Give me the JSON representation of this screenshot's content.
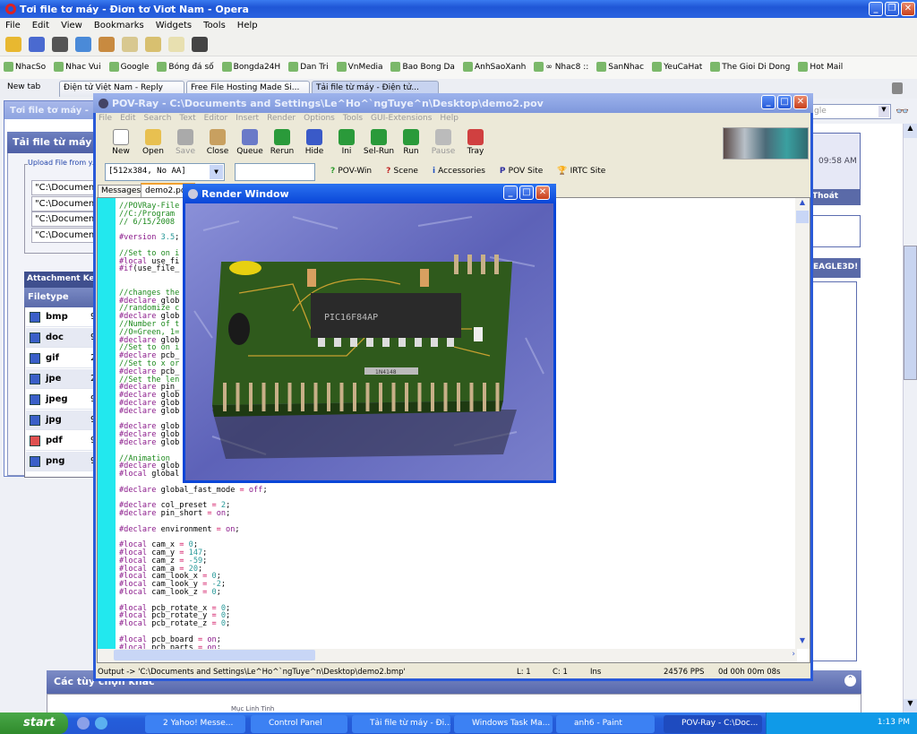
{
  "opera": {
    "title": "Tơi file tơ máy - Điơn tơ Viơt Nam - Opera",
    "menu": [
      "File",
      "Edit",
      "View",
      "Bookmarks",
      "Widgets",
      "Tools",
      "Help"
    ],
    "toolbar_icons": [
      "open-folder-icon",
      "save-icon",
      "print-icon",
      "find-icon",
      "home-icon",
      "notes-icon",
      "panels-icon",
      "pages-icon",
      "wand-icon"
    ],
    "bookmarks": [
      "NhacSo",
      "Nhac Vui",
      "Google",
      "Bóng đá số",
      "Bongda24H",
      "Dan Tri",
      "VnMedia",
      "Bao Bong Da",
      "AnhSaoXanh",
      "∞ Nhac8 ::",
      "SanNhac",
      "YeuCaHat",
      "The Gioi Di Dong",
      "Hot Mail"
    ],
    "tabs": [
      {
        "label": "New tab"
      },
      {
        "label": "Điện tử Việt Nam - Reply"
      },
      {
        "label": "Free File Hosting Made Si..."
      },
      {
        "label": "Tải file từ máy - Điện tử..."
      }
    ],
    "search_placeholder": "gle",
    "right_panel": {
      "time": "09:58 AM",
      "logout": "Thoát",
      "eagle": "EAGLE3D!"
    },
    "bottom": {
      "title": "Các tùy chọn khác",
      "fieldset": "Mục Linh Tinh"
    }
  },
  "upload_window": {
    "title": "Tơi file tơ máy -",
    "heading": "Tải file từ máy",
    "legend": "Upload File from y",
    "inputs": [
      "\"C:\\Documen",
      "\"C:\\Documen",
      "\"C:\\Documen",
      "\"C:\\Documen"
    ],
    "attach_title": "Attachment Key",
    "col_header": "Filetype",
    "rows": [
      {
        "ext": "bmp",
        "v": "9"
      },
      {
        "ext": "doc",
        "v": "9"
      },
      {
        "ext": "gif",
        "v": "2"
      },
      {
        "ext": "jpe",
        "v": "2"
      },
      {
        "ext": "jpeg",
        "v": "9"
      },
      {
        "ext": "jpg",
        "v": "9"
      },
      {
        "ext": "pdf",
        "v": "9"
      },
      {
        "ext": "png",
        "v": "9"
      }
    ]
  },
  "povray": {
    "title": "POV-Ray - C:\\Documents and Settings\\Le^Ho^`ngTuye^n\\Desktop\\demo2.pov",
    "menu": [
      "File",
      "Edit",
      "Search",
      "Text",
      "Editor",
      "Insert",
      "Render",
      "Options",
      "Tools",
      "GUI-Extensions",
      "Help"
    ],
    "toolbar": [
      "New",
      "Open",
      "Save",
      "Close",
      "Queue",
      "Rerun",
      "Hide",
      "Ini",
      "Sel-Run",
      "Run",
      "Pause",
      "Tray"
    ],
    "resolution": "[512x384, No AA]",
    "links": [
      "POV-Win",
      "Scene",
      "Accessories",
      "POV Site",
      "IRTC Site"
    ],
    "tabs": [
      "Messages",
      "demo2.pov"
    ],
    "code": [
      "//POVRay-File",
      "//C:/Program",
      "// 6/15/2008",
      "",
      "#version 3.5;",
      "",
      "//Set to on i",
      "#local use_fi",
      "#if(use_file_",
      "",
      "",
      "//changes the",
      "#declare glob",
      "//randomize c",
      "#declare glob",
      "//Number of t",
      "//O=Green, 1=",
      "#declare glob",
      "//Set to on i",
      "#declare pcb_",
      "//Set to x or",
      "#declare pcb_",
      "//Set the len",
      "#declare pin_",
      "#declare glob",
      "#declare glob",
      "#declare glob",
      "",
      "#declare glob",
      "#declare glob",
      "#declare glob",
      "",
      "//Animation",
      "#declare glob",
      "#local global",
      "",
      "#declare global_fast_mode = off;",
      "",
      "#declare col_preset = 2;",
      "#declare pin_short = on;",
      "",
      "#declare environment = on;",
      "",
      "#local cam_x = 0;",
      "#local cam_y = 147;",
      "#local cam_z = -59;",
      "#local cam_a = 20;",
      "#local cam_look_x = 0;",
      "#local cam_look_y = -2;",
      "#local cam_look_z = 0;",
      "",
      "#local pcb_rotate_x = 0;",
      "#local pcb_rotate_y = 0;",
      "#local pcb_rotate_z = 0;",
      "",
      "#local pcb_board = on;",
      "#local pcb_parts = on;"
    ],
    "status": {
      "output": "Output -> 'C:\\Documents and Settings\\Le^Ho^`ngTuye^n\\Desktop\\demo2.bmp'",
      "line": "L: 1",
      "col": "C: 1",
      "mode": "Ins",
      "pps": "24576 PPS",
      "time": "0d 00h 00m 08s"
    }
  },
  "render_window": {
    "title": "Render Window",
    "chip_label": "PIC16F84AP",
    "diode_label": "1N4148"
  },
  "taskbar": {
    "start": "start",
    "tasks": [
      "2 Yahoo! Messe...",
      "Control Panel",
      "Tải file từ máy - Đi...",
      "Windows Task Ma...",
      "anh6 - Paint",
      "POV-Ray - C:\\Doc..."
    ],
    "clock": "1:13 PM"
  }
}
